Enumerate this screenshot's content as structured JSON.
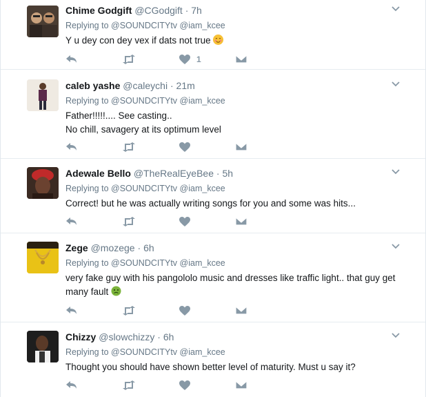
{
  "tweets": [
    {
      "name": "Chime Godgift",
      "handle": "@CGodgift",
      "time": "7h",
      "replying_label": "Replying to",
      "mentions": "@SOUNDCITYtv @iam_kcee",
      "lines": [
        "Y u dey con dey vex if dats not true"
      ],
      "emoji": "blushing-face",
      "like_count": "1"
    },
    {
      "name": "caleb yashe",
      "handle": "@caleychi",
      "time": "21m",
      "replying_label": "Replying to",
      "mentions": "@SOUNDCITYtv @iam_kcee",
      "lines": [
        "Father!!!!!.... See casting..",
        "No chill, savagery at its optimum level"
      ],
      "like_count": ""
    },
    {
      "name": "Adewale Bello",
      "handle": "@TheRealEyeBee",
      "time": "5h",
      "replying_label": "Replying to",
      "mentions": "@SOUNDCITYtv @iam_kcee",
      "lines": [
        "Correct! but he was actually writing songs for you and some was hits..."
      ],
      "like_count": ""
    },
    {
      "name": "Zege",
      "handle": "@mozege",
      "time": "6h",
      "replying_label": "Replying to",
      "mentions": "@SOUNDCITYtv @iam_kcee",
      "lines": [
        "very fake guy with his pangololo music and dresses like traffic light.. that guy get",
        "many fault"
      ],
      "emoji": "nauseated-face",
      "like_count": ""
    },
    {
      "name": "Chizzy",
      "handle": "@slowchizzy",
      "time": "6h",
      "replying_label": "Replying to",
      "mentions": "@SOUNDCITYtv @iam_kcee",
      "lines": [
        "Thought you should have shown better level of maturity. Must u say it?"
      ],
      "like_count": ""
    }
  ],
  "colors": {
    "icon": "#8899a6",
    "secondary_text": "#657786",
    "divider": "#e6ecf0"
  },
  "icons": [
    "reply-icon",
    "retweet-icon",
    "like-icon",
    "message-icon",
    "chevron-down-icon"
  ]
}
